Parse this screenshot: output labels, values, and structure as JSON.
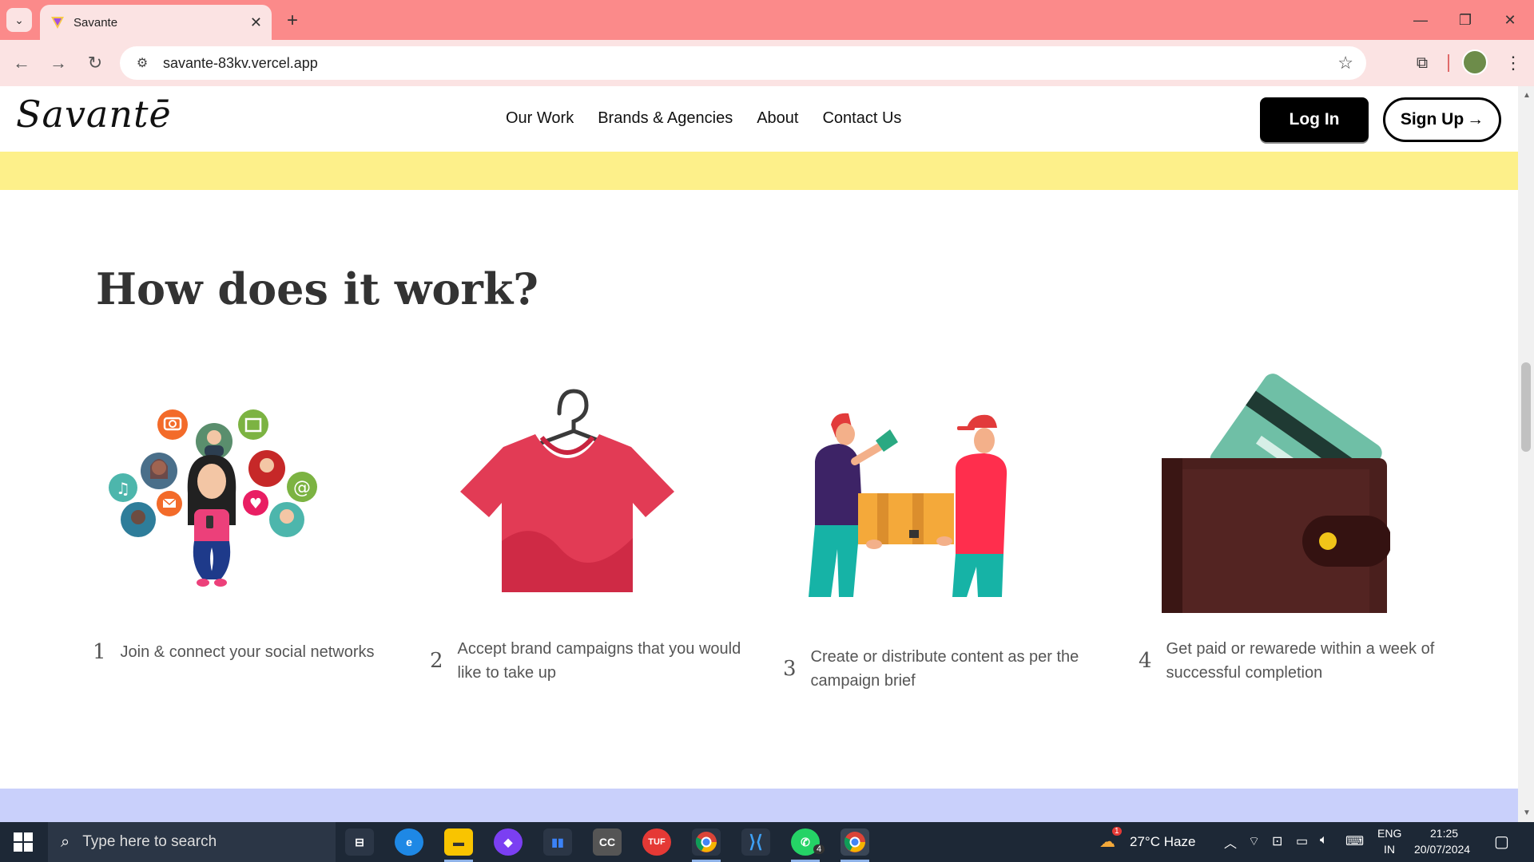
{
  "browser": {
    "tab_title": "Savante",
    "url": "savante-83kv.vercel.app",
    "new_tab": "+",
    "close_tab": "✕"
  },
  "site": {
    "logo": "Savantē",
    "nav": [
      "Our Work",
      "Brands & Agencies",
      "About",
      "Contact Us"
    ],
    "login": "Log In",
    "signup": "Sign Up",
    "signup_arrow": "→"
  },
  "section": {
    "title": "How does it work?",
    "steps": [
      {
        "num": "1",
        "text": "Join & connect your social networks"
      },
      {
        "num": "2",
        "text": "Accept brand campaigns that you would like to take up"
      },
      {
        "num": "3",
        "text": "Create or distribute content as per the campaign brief"
      },
      {
        "num": "4",
        "text": "Get paid or rewarede within a week of successful completion"
      }
    ]
  },
  "taskbar": {
    "search_placeholder": "Type here to search",
    "weather": "27°C  Haze",
    "lang_top": "ENG",
    "lang_bottom": "IN",
    "time": "21:25",
    "date": "20/07/2024",
    "whatsapp_badge": "4",
    "weather_badge": "1"
  },
  "colors": {
    "tabstrip": "#fb8a8a",
    "toolbar": "#fbe3e3",
    "yellow_band": "#fdf08a",
    "lavender_band": "#c9d0fb",
    "shirt": "#e23b55",
    "wallet": "#4a1f1d",
    "card": "#6fbfa6"
  }
}
